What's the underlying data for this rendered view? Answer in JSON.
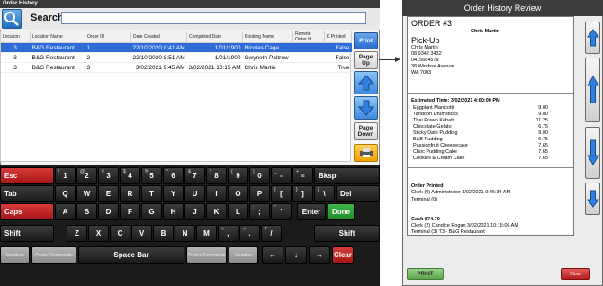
{
  "left_window": {
    "title": "Order History",
    "search_label": "Search:",
    "search_value": "",
    "columns": [
      "Location",
      "Location Name",
      "Order ID",
      "Date Created",
      "Completed Date",
      "Booking Name",
      "Remote Order Id",
      "K Printed"
    ],
    "rows": [
      [
        "3",
        "B&G Restaurant",
        "1",
        "22/10/2020 8:41 AM",
        "1/01/1900",
        "Nicolas Cage",
        "",
        "False"
      ],
      [
        "3",
        "B&G Restaurant",
        "2",
        "22/10/2020 8:51 AM",
        "1/01/1900",
        "Gwyneth Paltrow",
        "",
        "False"
      ],
      [
        "3",
        "B&G Restaurant",
        "3",
        "3/02/2021 9:45 AM",
        "3/02/2021 10:15 AM",
        "Chris Martin",
        "",
        "True"
      ]
    ],
    "selected_row": 0,
    "side_buttons": {
      "print": "Print",
      "page_up": "Page Up",
      "page_down": "Page Down"
    }
  },
  "keyboard": {
    "esc": "Esc",
    "bksp": "Bksp",
    "tab": "Tab",
    "del": "Del",
    "caps": "Caps",
    "enter": "Enter",
    "done": "Done",
    "shift": "Shift",
    "space": "Space Bar",
    "clear": "Clear",
    "variables": "Variables",
    "printer_commands": "Printer Commands",
    "arrows": {
      "left": "←",
      "down": "↓",
      "right": "→"
    },
    "row1_main": [
      "1",
      "2",
      "3",
      "4",
      "5",
      "6",
      "7",
      "8",
      "9",
      "0",
      "-",
      "="
    ],
    "row1_sub": [
      "!",
      "@",
      "#",
      "$",
      "%",
      "^",
      "&",
      "*",
      "(",
      ")",
      "_",
      "+"
    ],
    "row2": [
      "Q",
      "W",
      "E",
      "R",
      "T",
      "Y",
      "U",
      "I",
      "O",
      "P"
    ],
    "row2_brackets": [
      "[",
      "]",
      "\\"
    ],
    "row2_brackets_sub": [
      "{",
      "}",
      "|"
    ],
    "row3": [
      "A",
      "S",
      "D",
      "F",
      "G",
      "H",
      "J",
      "K",
      "L"
    ],
    "row3_punct": [
      ";",
      "'"
    ],
    "row3_punct_sub": [
      ":",
      "\""
    ],
    "row4": [
      "Z",
      "X",
      "C",
      "V",
      "B",
      "N",
      "M"
    ],
    "row4_punct": [
      ",",
      ".",
      "/"
    ],
    "row4_punct_sub": [
      "<",
      ">",
      "?"
    ]
  },
  "right_window": {
    "title": "Order History Review",
    "order_no": "ORDER #3",
    "customer_center": "Chris Martin",
    "type": "Pick-Up",
    "customer": [
      "Chris Martin",
      "08 9342 3432",
      "0415664579",
      "38 Windsor Avenue",
      "WA 7003"
    ],
    "estimated_time": "Estimated Time: 3/02/2021 4:00:00 PM",
    "items": [
      {
        "name": "Eggplant Manicotti",
        "price": "9.00"
      },
      {
        "name": "Tandoori Drumsticks",
        "price": "9.00"
      },
      {
        "name": "Thai Prawn Kebab",
        "price": "11.25"
      },
      {
        "name": "Chocolate Gelato",
        "price": "6.75"
      },
      {
        "name": "Sticky Date Pudding",
        "price": "9.00"
      },
      {
        "name": "B&B Pudding",
        "price": "6.75"
      },
      {
        "name": "Passionfruit Cheesecake",
        "price": "7.65"
      },
      {
        "name": "Choc Pudding Cake",
        "price": "7.65"
      },
      {
        "name": "Cookies & Cream Cake",
        "price": "7.65"
      }
    ],
    "order_printed": "Order Printed",
    "printed_clerk": "Clerk (0) Administrator 3/02/2021 9:46:34 AM",
    "printed_terminal": "Terminal (0)",
    "cash": "Cash $74.70",
    "cash_clerk": "Clerk (2) Candice Rogan 3/02/2021 10:15:06 AM",
    "cash_terminal": "Terminal (3) T3 - B&G Restaurant",
    "print_button": "PRINT",
    "close_button": "Close"
  }
}
